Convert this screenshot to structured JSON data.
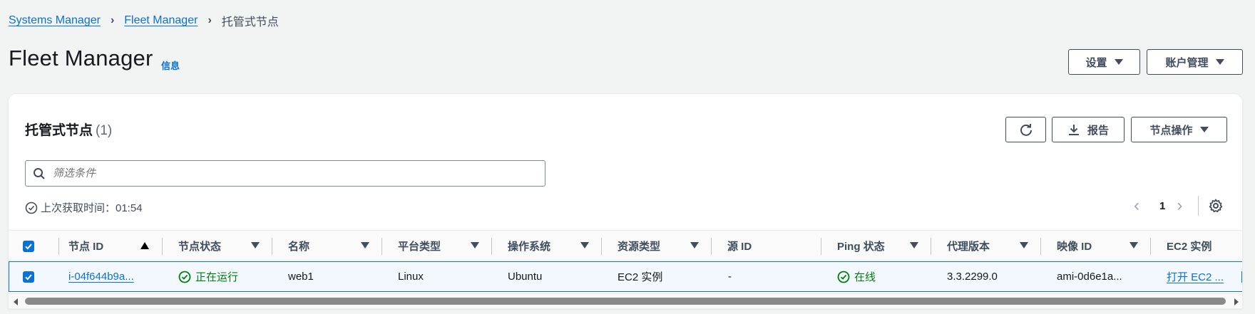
{
  "breadcrumb": {
    "items": [
      "Systems Manager",
      "Fleet Manager"
    ],
    "current": "托管式节点"
  },
  "header": {
    "title": "Fleet Manager",
    "info": "信息",
    "settings_label": "设置",
    "account_label": "账户管理"
  },
  "panel": {
    "title": "托管式节点",
    "count": "(1)",
    "report_label": "报告",
    "node_actions_label": "节点操作",
    "search_placeholder": "筛选条件",
    "last_fetch": "上次获取时间：01:54",
    "page": "1"
  },
  "table": {
    "columns": [
      "节点 ID",
      "节点状态",
      "名称",
      "平台类型",
      "操作系统",
      "资源类型",
      "源 ID",
      "Ping 状态",
      "代理版本",
      "映像 ID",
      "EC2 实例"
    ],
    "rows": [
      {
        "node_id": "i-04f644b9a...",
        "node_status": "正在运行",
        "name": "web1",
        "platform": "Linux",
        "os": "Ubuntu",
        "resource_type": "EC2 实例",
        "source_id": "-",
        "ping": "在线",
        "agent_version": "3.3.2299.0",
        "image_id": "ami-0d6e1a...",
        "ec2_instance": "打开 EC2 ..."
      }
    ]
  },
  "colors": {
    "link": "#0972d3",
    "success": "#037f0c",
    "text": "#16191f",
    "muted": "#414d5c"
  }
}
